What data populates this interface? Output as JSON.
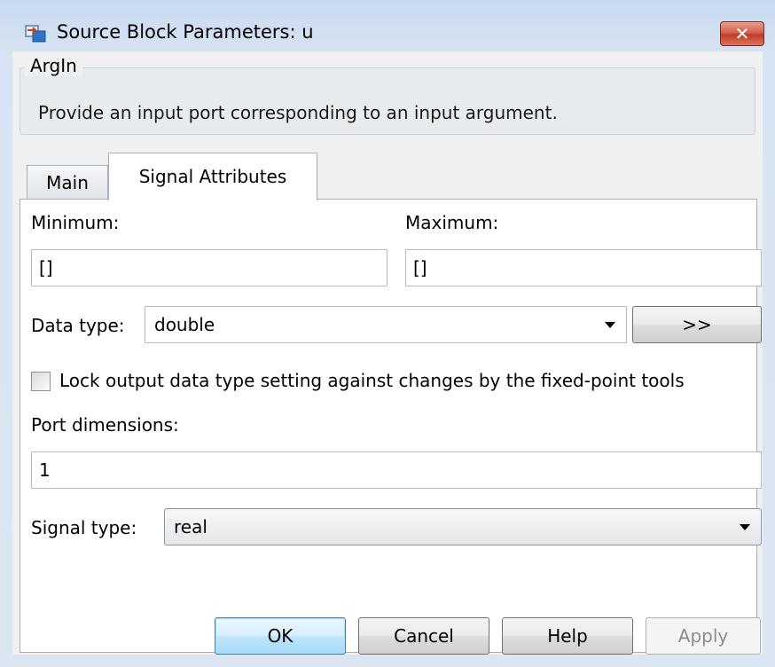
{
  "window": {
    "title": "Source Block Parameters: u",
    "close_glyph": "✕",
    "app_icon": "simulink-block-icon"
  },
  "description": {
    "block_type": "ArgIn",
    "text": "Provide an input port corresponding to an input argument."
  },
  "tabs": [
    {
      "label": "Main",
      "active": false
    },
    {
      "label": "Signal Attributes",
      "active": true
    }
  ],
  "signal_attributes": {
    "minimum_label": "Minimum:",
    "minimum_value": "[]",
    "maximum_label": "Maximum:",
    "maximum_value": "[]",
    "data_type_label": "Data type:",
    "data_type_value": "double",
    "data_type_assistant_label": ">>",
    "lock_label": "Lock output data type setting against changes by the fixed-point tools",
    "lock_checked": false,
    "port_dimensions_label": "Port dimensions:",
    "port_dimensions_value": "1",
    "signal_type_label": "Signal type:",
    "signal_type_value": "real"
  },
  "buttons": {
    "ok": "OK",
    "cancel": "Cancel",
    "help": "Help",
    "apply": "Apply"
  },
  "colors": {
    "ok_button_border": "#3c7fb1",
    "close_button": "#c23c26",
    "window_frame": "#d6e3f2"
  }
}
